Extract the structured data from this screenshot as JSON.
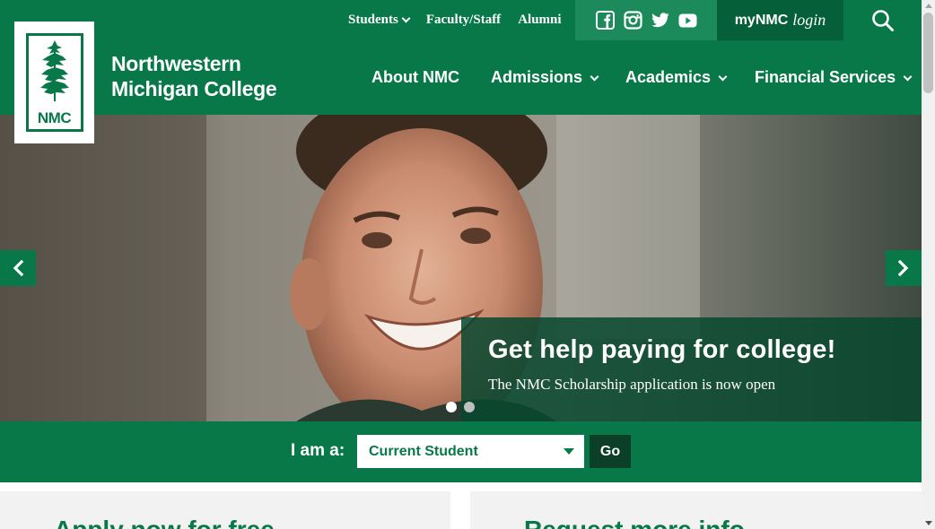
{
  "colors": {
    "brand_green": "#087849",
    "dark_green": "#056039",
    "go_button": "#0b3f28"
  },
  "utility": {
    "links": [
      {
        "label": "Students",
        "has_dropdown": true
      },
      {
        "label": "Faculty/Staff",
        "has_dropdown": false
      },
      {
        "label": "Alumni",
        "has_dropdown": false
      }
    ],
    "social_icons": [
      "facebook-icon",
      "instagram-icon",
      "twitter-icon",
      "youtube-icon"
    ],
    "mynmc": {
      "bold": "myNMC",
      "italic": "login"
    },
    "search_icon": "search-icon"
  },
  "branding": {
    "logo_text": "NMC",
    "college_name_line1": "Northwestern",
    "college_name_line2": "Michigan College"
  },
  "nav": {
    "items": [
      {
        "label": "About NMC",
        "has_dropdown": false
      },
      {
        "label": "Admissions",
        "has_dropdown": true
      },
      {
        "label": "Academics",
        "has_dropdown": true
      },
      {
        "label": "Financial Services",
        "has_dropdown": true
      }
    ]
  },
  "hero": {
    "caption_title": "Get help paying for college!",
    "caption_subtitle": "The NMC Scholarship application is now open",
    "slide_count": 2,
    "active_slide": 1
  },
  "iam": {
    "label": "I am a:",
    "selected": "Current Student",
    "go_label": "Go"
  },
  "cards": {
    "left_title": "Apply now for free",
    "right_title": "Request more info"
  }
}
